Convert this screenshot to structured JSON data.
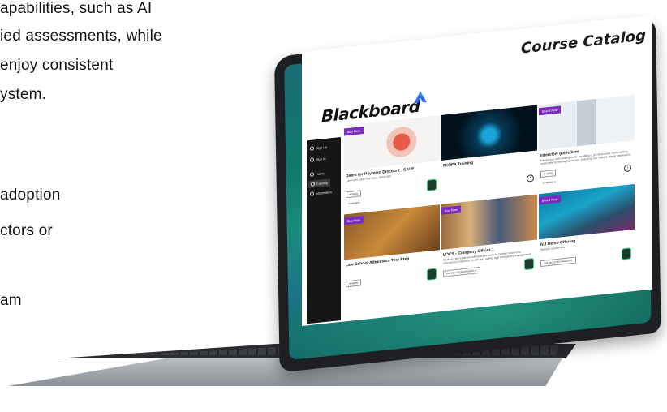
{
  "marketing": {
    "line1": "apabilities, such as AI",
    "line2": "ied assessments, while",
    "line3": "enjoy consistent",
    "line4": "ystem.",
    "line5": "adoption",
    "line6": "ctors or",
    "line7": "am"
  },
  "app": {
    "logo": "Blackboard",
    "page_title": "Course Catalog",
    "sidebar": [
      {
        "label": "Sign Up"
      },
      {
        "label": "Sign In"
      },
      {
        "label": "Home"
      },
      {
        "label": "Catalog"
      },
      {
        "label": "Information"
      }
    ],
    "cards": [
      {
        "badge": "Buy Now",
        "title": "Dates for Payment Discount - SALE",
        "subtitle": "Level 600 start Test Date, 05/05/100",
        "tag": "HYBRID",
        "extra": "Comments",
        "image": "salad",
        "indicator": "badge"
      },
      {
        "badge": "",
        "title": "FERPA Training",
        "subtitle": "",
        "tag": "",
        "extra": "",
        "image": "cyber",
        "indicator": "info"
      },
      {
        "badge": "Enroll Now",
        "title": "Interview guidelines",
        "subtitle": "Equips you with strategies for excelling in job interviews, from crafting responses to managing nerves, ensuring you make a strong impression.",
        "tag": "HYBRID",
        "extra": "Contributors",
        "image": "person",
        "indicator": "info"
      },
      {
        "badge": "Buy Now",
        "title": "Law School Admission Test Prep",
        "subtitle": "",
        "tag": "HYBRID",
        "extra": "",
        "image": "lsat",
        "indicator": "badge"
      },
      {
        "badge": "Buy Now",
        "title": "LOCS - Company Officer 1",
        "subtitle": "Students will examine critical areas such as human resources, emergency response, health and safety, and emergency management.",
        "tag": "ONLINE ASYNCHRONOUS",
        "extra": "",
        "image": "firefighters",
        "indicator": "badge"
      },
      {
        "badge": "Enroll Now",
        "title": "NU Demo Offering",
        "subtitle": "Sample course test.",
        "tag": "ONLINE SYNCHRONOUS",
        "extra": "",
        "image": "reef",
        "indicator": "badge"
      }
    ]
  },
  "colors": {
    "buy_badge": "#7b2cbf",
    "sidebar": "#161616",
    "logo_mark": "#2a6df0"
  }
}
